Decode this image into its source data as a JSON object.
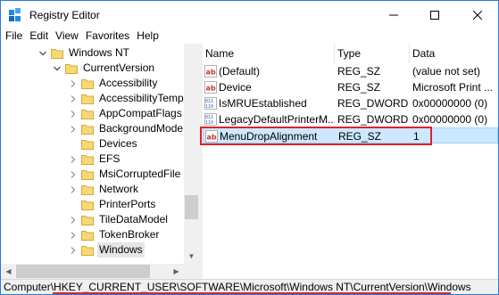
{
  "window": {
    "title": "Registry Editor",
    "title_bar_buttons": [
      "minimize",
      "maximize",
      "close"
    ]
  },
  "menu": [
    "File",
    "Edit",
    "View",
    "Favorites",
    "Help"
  ],
  "tree": [
    {
      "label": "Windows NT",
      "expander": "expanded",
      "selected": false
    },
    {
      "label": "CurrentVersion",
      "expander": "expanded",
      "selected": false
    },
    {
      "label": "Accessibility",
      "expander": "collapsed",
      "selected": false
    },
    {
      "label": "AccessibilityTemp",
      "expander": "collapsed",
      "selected": false
    },
    {
      "label": "AppCompatFlags",
      "expander": "collapsed",
      "selected": false
    },
    {
      "label": "BackgroundMode",
      "expander": "collapsed",
      "selected": false
    },
    {
      "label": "Devices",
      "expander": "none",
      "selected": false
    },
    {
      "label": "EFS",
      "expander": "collapsed",
      "selected": false
    },
    {
      "label": "MsiCorruptedFile",
      "expander": "collapsed",
      "selected": false
    },
    {
      "label": "Network",
      "expander": "collapsed",
      "selected": false
    },
    {
      "label": "PrinterPorts",
      "expander": "none",
      "selected": false
    },
    {
      "label": "TileDataModel",
      "expander": "collapsed",
      "selected": false
    },
    {
      "label": "TokenBroker",
      "expander": "collapsed",
      "selected": false
    },
    {
      "label": "Windows",
      "expander": "collapsed",
      "selected": true
    }
  ],
  "list": {
    "headers": {
      "name": "Name",
      "type": "Type",
      "data": "Data"
    },
    "rows": [
      {
        "name": "(Default)",
        "type": "REG_SZ",
        "data": "(value not set)",
        "icon": "string-value-icon",
        "selected": false
      },
      {
        "name": "Device",
        "type": "REG_SZ",
        "data": "Microsoft Print ...",
        "icon": "string-value-icon",
        "selected": false
      },
      {
        "name": "IsMRUEstablished",
        "type": "REG_DWORD",
        "data": "0x00000000 (0)",
        "icon": "binary-value-icon",
        "selected": false
      },
      {
        "name": "LegacyDefaultPrinterM...",
        "type": "REG_DWORD",
        "data": "0x00000000 (0)",
        "icon": "binary-value-icon",
        "selected": false
      },
      {
        "name": "MenuDropAlignment",
        "type": "REG_SZ",
        "data": "1",
        "icon": "string-value-icon",
        "selected": true
      }
    ]
  },
  "status": {
    "path": "Computer\\HKEY_CURRENT_USER\\SOFTWARE\\Microsoft\\Windows NT\\CurrentVersion\\Windows"
  },
  "colors": {
    "accent_border": "#2b79d7",
    "selection_fill": "#cce8ff",
    "annotation_red": "#e0202e",
    "folder_yellow": "#f8d775"
  }
}
